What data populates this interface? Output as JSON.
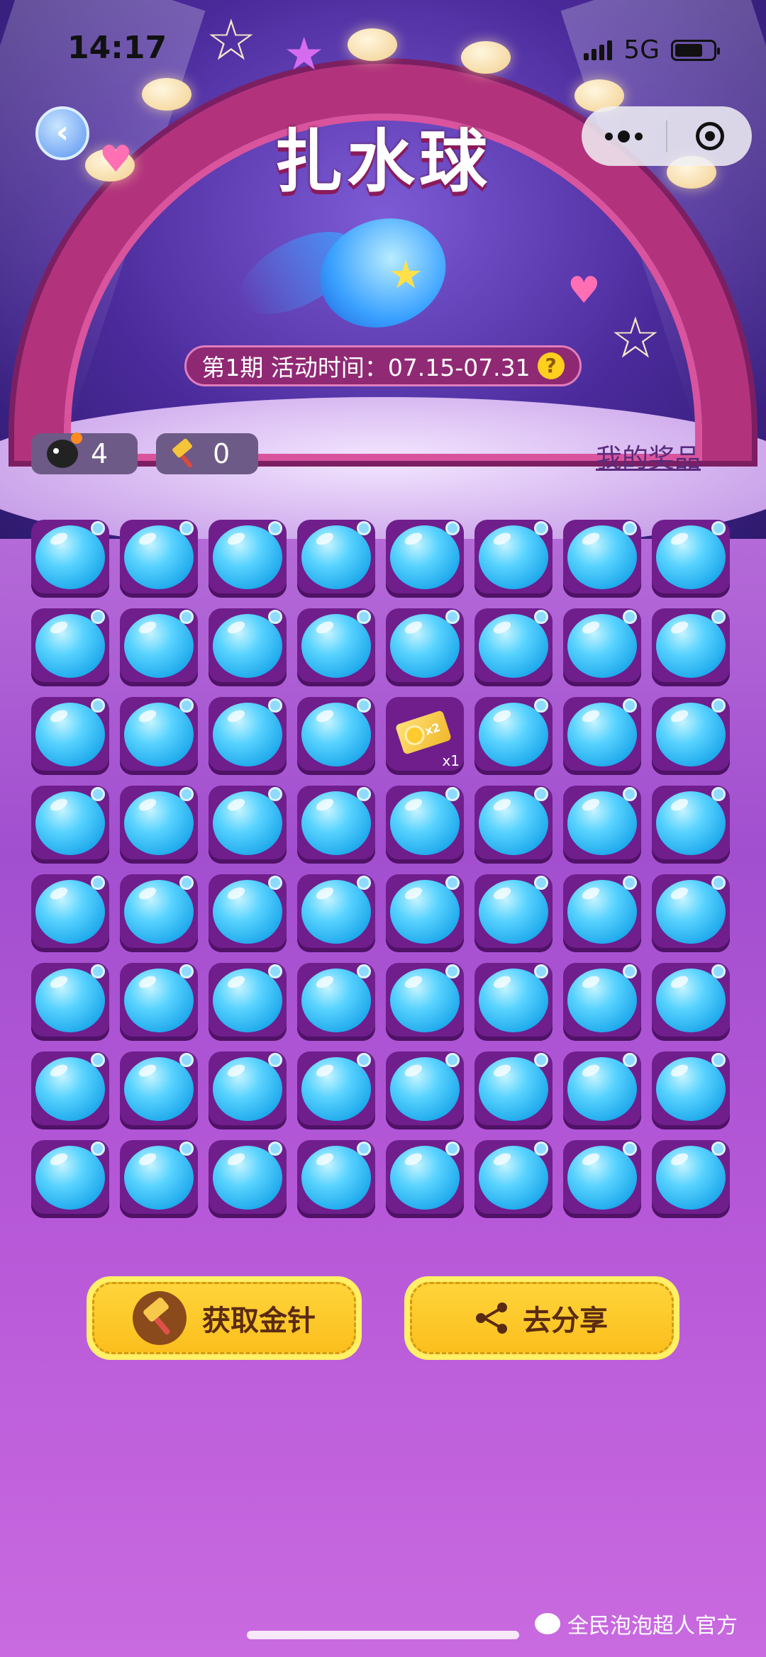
{
  "status_bar": {
    "time": "14:17",
    "network": "5G",
    "battery_pct": 60
  },
  "header": {
    "title": "扎水球",
    "back_icon": "chevron-left-icon",
    "menu_icon": "more-dots-icon",
    "close_icon": "target-icon"
  },
  "activity": {
    "period_text": "第1期  活动时间：07.15-07.31",
    "help_symbol": "?"
  },
  "counters": {
    "bomb_count": "4",
    "needle_count": "0"
  },
  "prize_link": "我的奖品",
  "grid": {
    "rows": 8,
    "cols": 8,
    "revealed": [
      {
        "row": 3,
        "col": 5,
        "prize": "x2",
        "count": "x1"
      }
    ]
  },
  "buttons": {
    "get_needle": "获取金针",
    "share": "去分享"
  },
  "watermark": "全民泡泡超人官方",
  "colors": {
    "balloon": "#19a5ea",
    "cell": "#6f1e8c",
    "button": "#fbbf1d",
    "arch": "#b2337c"
  }
}
